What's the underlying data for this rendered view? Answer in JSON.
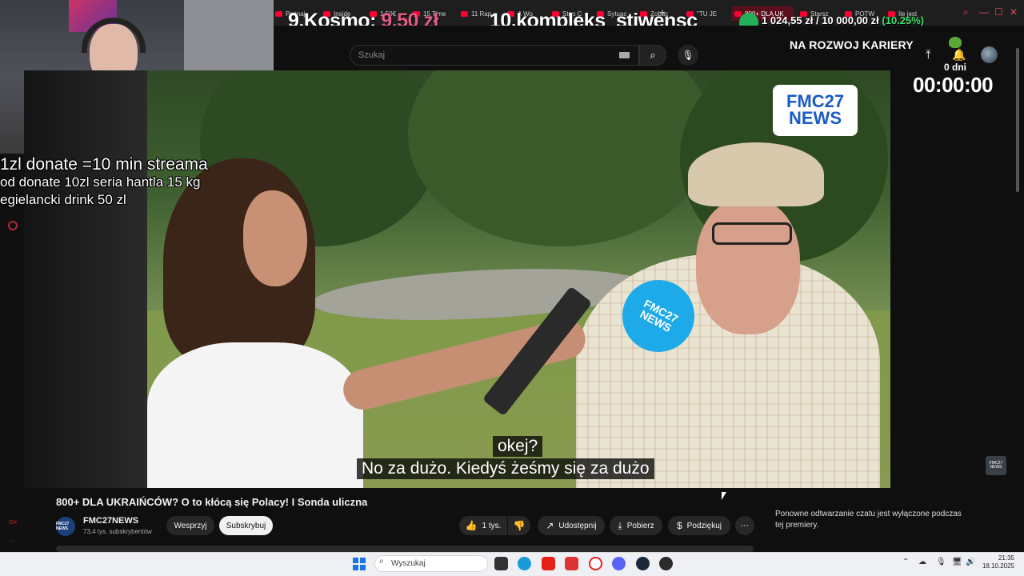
{
  "browser": {
    "tabs": [
      {
        "label": "Poznaj",
        "active": false
      },
      {
        "label": "Inside",
        "active": false
      },
      {
        "label": "1,50€",
        "active": false
      },
      {
        "label": "15 Time",
        "active": false
      },
      {
        "label": "11 Rap",
        "active": false
      },
      {
        "label": "A Wo",
        "active": false
      },
      {
        "label": "Stop C",
        "active": false
      },
      {
        "label": "Sytuac",
        "active": false
      },
      {
        "label": "Zobac",
        "active": false
      },
      {
        "label": "\"TU JE",
        "active": false
      },
      {
        "label": "800+ DLA UK",
        "active": true
      },
      {
        "label": "Starsz",
        "active": false
      },
      {
        "label": "POTW",
        "active": false
      },
      {
        "label": "Ile jest",
        "active": false
      }
    ],
    "new_tab": "+"
  },
  "stream_overlay": {
    "donor_9_rank": "9.",
    "donor_9_name": "Kosmo:",
    "donor_9_amount": "9,50 zł",
    "donor_10_rank": "10.",
    "donor_10_name": "kompleks_stiwensc",
    "goal_current": "1 024,55 zł",
    "goal_separator": "/",
    "goal_target": "10 000,00 zł",
    "goal_percent": "(10.25%)",
    "goal_fraction": 0.1025,
    "career_label": "NA ROZWOJ KARIERY",
    "days_label": "0 dni",
    "timer": "00:00:00",
    "donate_line1": "1zl donate =10 min streama",
    "donate_line2": "od donate 10zl seria hantla 15 kg",
    "donate_line3": "egielancki drink 50 zl"
  },
  "youtube": {
    "search_placeholder": "Szukaj",
    "video_title": "800+ DLA UKRAIŃCÓW? O to kłócą się Polacy! I Sonda uliczna",
    "channel_name": "FMC27NEWS",
    "channel_subs": "73,4 tys. subskrybentów",
    "channel_avatar_text": "FMC27 NEWS",
    "support_label": "Wesprzyj",
    "subscribe_label": "Subskrybuj",
    "likes_label": "1 tys.",
    "share_label": "Udostępnij",
    "download_label": "Pobierz",
    "thanks_label": "Podziękuj",
    "more_label": "⋯",
    "chat_disabled": "Ponowne odtwarzanie czatu jest wyłączone podczas tej premiery.",
    "video_logo_line1": "FMC27",
    "video_logo_line2": "NEWS",
    "mic_logo": "FMC27 NEWS",
    "watermark": "FMC27 NEWS",
    "subtitle_line1": "okej?",
    "subtitle_line2": "No za dużo. Kiedyś żeśmy się za dużo"
  },
  "taskbar": {
    "search_placeholder": "Wyszukaj",
    "time": "21:35",
    "date": "18.10.2025"
  },
  "sidebar": {
    "gx_label": "GX",
    "more_label": "···"
  },
  "colors": {
    "youtube_red": "#ff0033",
    "overlay_pink": "#e05c84",
    "goal_green": "#3ee06d",
    "fmc_blue": "#1a5bc4",
    "mic_blue": "#1eaae8"
  }
}
